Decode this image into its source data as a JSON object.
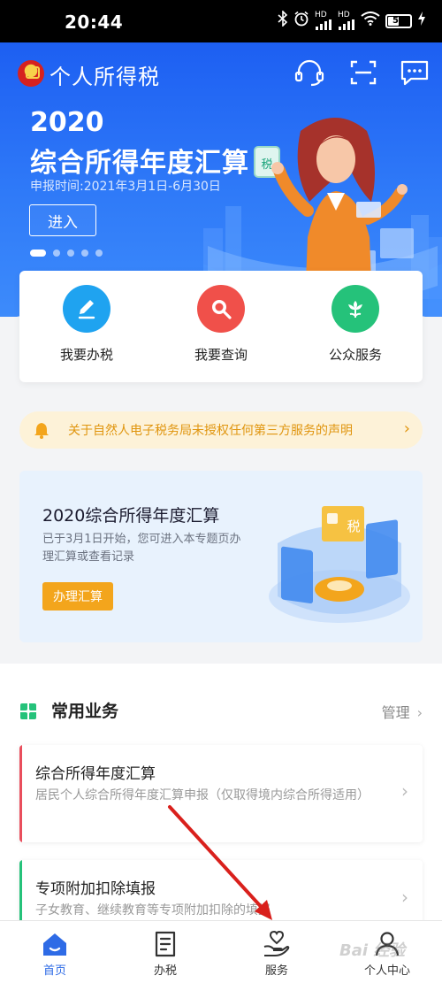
{
  "status_bar": {
    "time": "20:44",
    "battery": "50",
    "hd_label": "HD",
    "icons": [
      "bluetooth-icon",
      "alarm-icon",
      "signal-icon",
      "wifi-icon",
      "battery-icon",
      "charging-icon"
    ]
  },
  "header": {
    "app_title": "个人所得税",
    "icons": [
      "customer-service-icon",
      "scan-icon",
      "message-icon"
    ]
  },
  "banner": {
    "year": "2020",
    "title": "综合所得年度汇算",
    "subtitle": "申报时间:2021年3月1日-6月30日",
    "enter_label": "进入",
    "badge_char": "税",
    "slide_count": 5,
    "active_slide": 1
  },
  "quick_services": [
    {
      "label": "我要办税",
      "icon": "pen-edit-icon",
      "color": "#1fa3f0"
    },
    {
      "label": "我要查询",
      "icon": "search-icon",
      "color": "#f0504a"
    },
    {
      "label": "公众服务",
      "icon": "flower-icon",
      "color": "#25c27a"
    }
  ],
  "notice": {
    "text": "关于自然人电子税务局未授权任何第三方服务的声明",
    "icon": "bell-icon",
    "color": "#e0950e"
  },
  "promo": {
    "title": "2020综合所得年度汇算",
    "desc": "已于3月1日开始，您可进入本专题页办理汇算或查看记录",
    "button_label": "办理汇算",
    "badge_char": "税"
  },
  "common_business": {
    "title": "常用业务",
    "manage_label": "管理",
    "items": [
      {
        "title": "综合所得年度汇算",
        "desc": "居民个人综合所得年度汇算申报（仅取得境内综合所得适用）",
        "accent": "#e94e5c"
      },
      {
        "title": "专项附加扣除填报",
        "desc": "子女教育、继续教育等专项附加扣除的填报",
        "accent": "#25c27a"
      }
    ]
  },
  "tabbar": {
    "tabs": [
      {
        "label": "首页",
        "icon": "home-icon",
        "active": true
      },
      {
        "label": "办税",
        "icon": "document-icon",
        "active": false
      },
      {
        "label": "服务",
        "icon": "heart-hand-icon",
        "active": false
      },
      {
        "label": "个人中心",
        "icon": "person-icon",
        "active": false
      }
    ]
  },
  "watermark": "Bai 经验",
  "colors": {
    "brand_blue": "#2e6be6",
    "annotation_red": "#d9201c"
  }
}
